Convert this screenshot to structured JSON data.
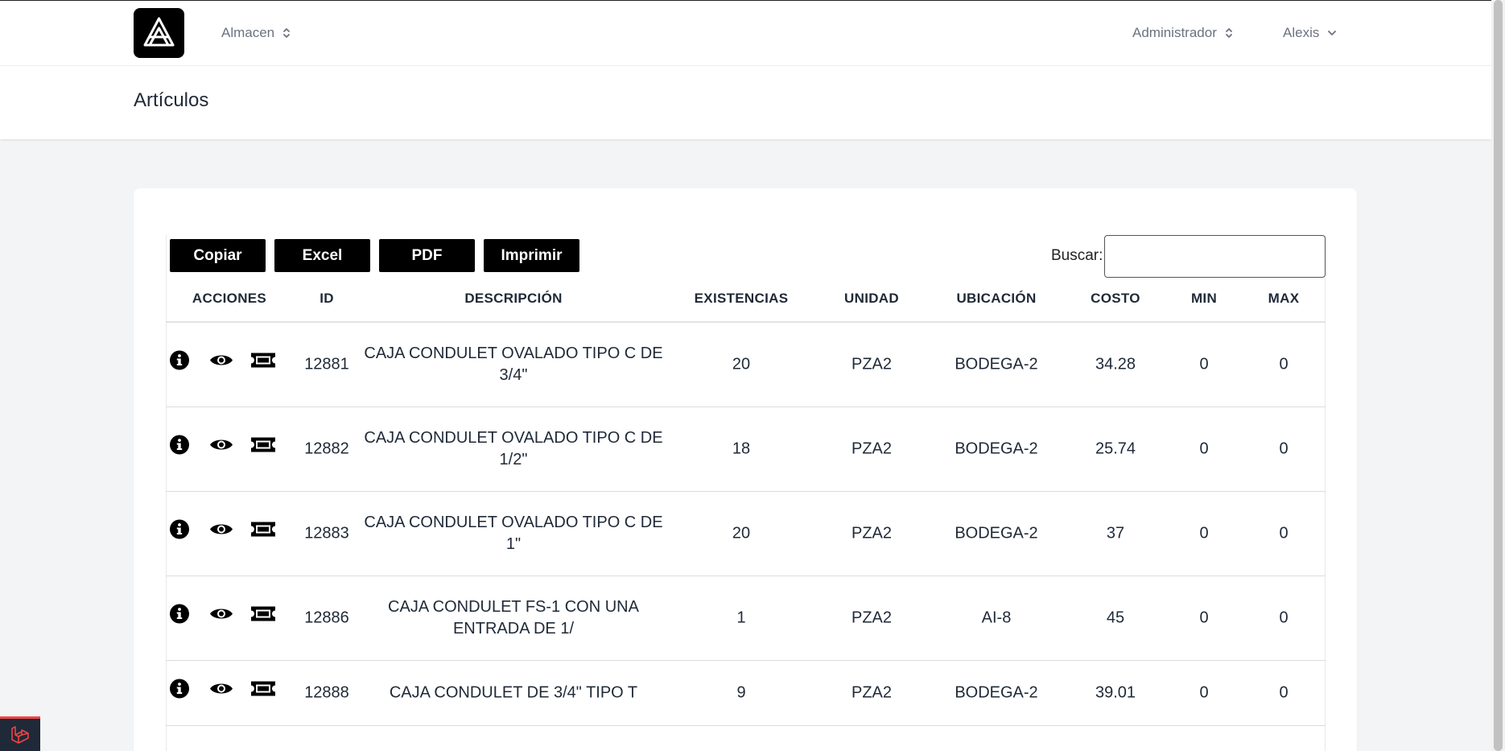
{
  "nav": {
    "menu_almacen": "Almacen",
    "menu_role": "Administrador",
    "menu_user": "Alexis"
  },
  "header": {
    "title": "Artículos"
  },
  "toolbar": {
    "copy_label": "Copiar",
    "excel_label": "Excel",
    "pdf_label": "PDF",
    "print_label": "Imprimir",
    "search_label": "Buscar:",
    "search_value": ""
  },
  "table": {
    "columns": [
      "ACCIONES",
      "ID",
      "DESCRIPCIÓN",
      "EXISTENCIAS",
      "UNIDAD",
      "UBICACIÓN",
      "COSTO",
      "MIN",
      "MAX"
    ],
    "rows": [
      {
        "id": "12881",
        "descripcion": "CAJA CONDULET OVALADO TIPO C DE 3/4\"",
        "existencias": "20",
        "unidad": "PZA2",
        "ubicacion": "BODEGA-2",
        "costo": "34.28",
        "min": "0",
        "max": "0"
      },
      {
        "id": "12882",
        "descripcion": "CAJA CONDULET OVALADO TIPO C DE 1/2\"",
        "existencias": "18",
        "unidad": "PZA2",
        "ubicacion": "BODEGA-2",
        "costo": "25.74",
        "min": "0",
        "max": "0"
      },
      {
        "id": "12883",
        "descripcion": "CAJA CONDULET OVALADO TIPO C DE 1\"",
        "existencias": "20",
        "unidad": "PZA2",
        "ubicacion": "BODEGA-2",
        "costo": "37",
        "min": "0",
        "max": "0"
      },
      {
        "id": "12886",
        "descripcion": "CAJA CONDULET FS-1 CON UNA ENTRADA DE 1/",
        "existencias": "1",
        "unidad": "PZA2",
        "ubicacion": "AI-8",
        "costo": "45",
        "min": "0",
        "max": "0"
      },
      {
        "id": "12888",
        "descripcion": "CAJA CONDULET DE 3/4\" TIPO T",
        "existencias": "9",
        "unidad": "PZA2",
        "ubicacion": "BODEGA-2",
        "costo": "39.01",
        "min": "0",
        "max": "0"
      }
    ],
    "row_actions": [
      "info-icon",
      "eye-icon",
      "ticket-icon"
    ]
  },
  "colors": {
    "button_bg": "#000000",
    "page_bg": "#f3f4f6",
    "laravel_red": "#ef4444"
  }
}
